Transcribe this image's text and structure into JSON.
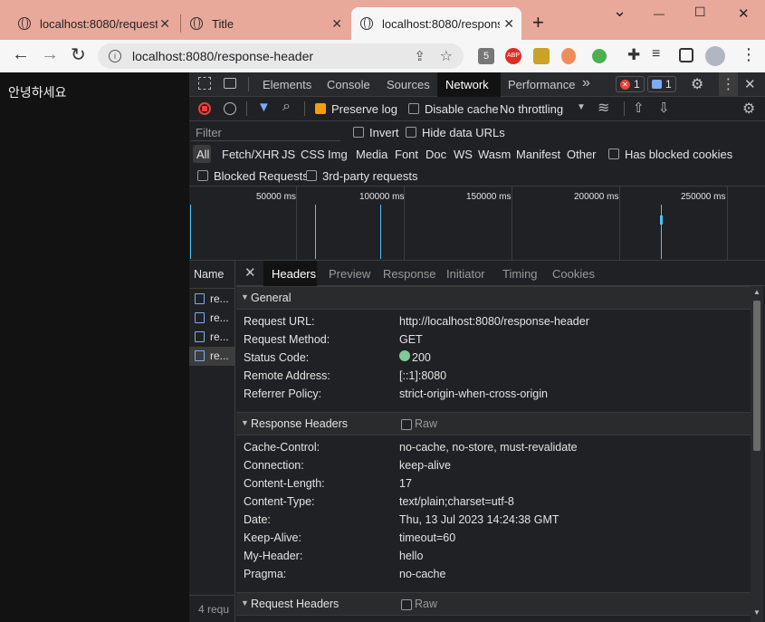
{
  "tabs": [
    {
      "title": "localhost:8080/request",
      "close": "✕"
    },
    {
      "title": "Title",
      "close": "✕"
    },
    {
      "title": "localhost:8080/respons",
      "close": "✕"
    }
  ],
  "new_tab": "+",
  "window_controls": {
    "chevron": "⌄",
    "min": "—",
    "max": "☐",
    "close": "✕"
  },
  "nav": {
    "back": "←",
    "forward": "→",
    "reload": "↻"
  },
  "address": "localhost:8080/response-header",
  "page": {
    "greeting": "안녕하세요"
  },
  "devtools": {
    "tabs": [
      "Elements",
      "Console",
      "Sources",
      "Network",
      "Performance"
    ],
    "active_tab": "Network",
    "more": "»",
    "errors": "1",
    "messages": "1",
    "toolbar": {
      "preserve_log": "Preserve log",
      "disable_cache": "Disable cache",
      "throttling": "No throttling"
    },
    "filter": {
      "placeholder": "Filter",
      "invert": "Invert",
      "hide_data_urls": "Hide data URLs"
    },
    "types": [
      "All",
      "Fetch/XHR",
      "JS",
      "CSS",
      "Img",
      "Media",
      "Font",
      "Doc",
      "WS",
      "Wasm",
      "Manifest",
      "Other"
    ],
    "has_blocked": "Has blocked cookies",
    "blocked_requests": "Blocked Requests",
    "third_party": "3rd-party requests",
    "timeline": [
      "50000 ms",
      "100000 ms",
      "150000 ms",
      "200000 ms",
      "250000 ms"
    ],
    "name_header": "Name",
    "requests": [
      "re...",
      "re...",
      "re...",
      "re..."
    ],
    "footer": "4 requ",
    "detail_tabs": [
      "Headers",
      "Preview",
      "Response",
      "Initiator",
      "Timing",
      "Cookies"
    ],
    "active_detail": "Headers",
    "general": {
      "title": "General",
      "rows": [
        {
          "k": "Request URL:",
          "v": "http://localhost:8080/response-header"
        },
        {
          "k": "Request Method:",
          "v": "GET"
        },
        {
          "k": "Status Code:",
          "v": "200"
        },
        {
          "k": "Remote Address:",
          "v": "[::1]:8080"
        },
        {
          "k": "Referrer Policy:",
          "v": "strict-origin-when-cross-origin"
        }
      ]
    },
    "response_headers": {
      "title": "Response Headers",
      "raw": "Raw",
      "rows": [
        {
          "k": "Cache-Control:",
          "v": "no-cache, no-store, must-revalidate"
        },
        {
          "k": "Connection:",
          "v": "keep-alive"
        },
        {
          "k": "Content-Length:",
          "v": "17"
        },
        {
          "k": "Content-Type:",
          "v": "text/plain;charset=utf-8"
        },
        {
          "k": "Date:",
          "v": "Thu, 13 Jul 2023 14:24:38 GMT"
        },
        {
          "k": "Keep-Alive:",
          "v": "timeout=60"
        },
        {
          "k": "My-Header:",
          "v": "hello"
        },
        {
          "k": "Pragma:",
          "v": "no-cache"
        }
      ]
    },
    "request_headers": {
      "title": "Request Headers",
      "raw": "Raw"
    }
  },
  "colors": {
    "accent": "#7cacf8",
    "status_ok": "#81c995",
    "error": "#ea4335",
    "preserve": "#f59e0b"
  }
}
